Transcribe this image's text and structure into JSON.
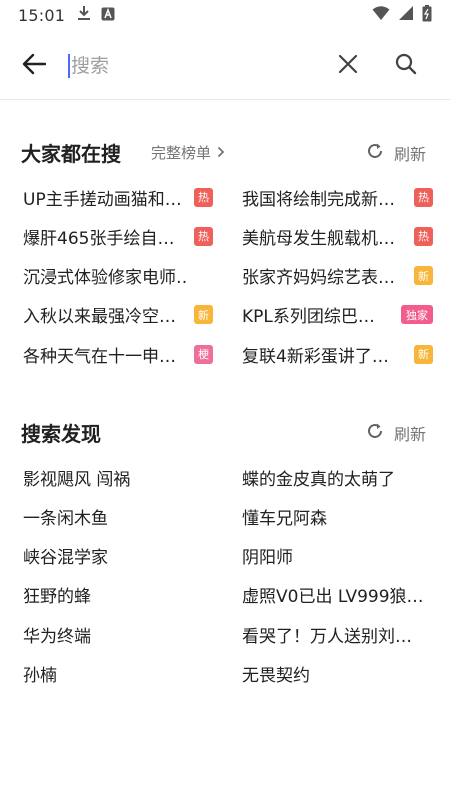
{
  "status_bar": {
    "time": "15:01"
  },
  "search": {
    "placeholder": "搜索"
  },
  "trending": {
    "title": "大家都在搜",
    "full_list_label": "完整榜单",
    "refresh_label": "刷新",
    "items": [
      {
        "text": "UP主手搓动画猫和…",
        "badge": "热",
        "badge_type": "hot"
      },
      {
        "text": "我国将绘制完成新…",
        "badge": "热",
        "badge_type": "hot"
      },
      {
        "text": "爆肝465张手绘自…",
        "badge": "热",
        "badge_type": "hot"
      },
      {
        "text": "美航母发生舰载机…",
        "badge": "热",
        "badge_type": "hot"
      },
      {
        "text": "沉浸式体验修家电师…",
        "badge": "",
        "badge_type": ""
      },
      {
        "text": "张家齐妈妈综艺表…",
        "badge": "新",
        "badge_type": "new"
      },
      {
        "text": "入秋以来最强冷空…",
        "badge": "新",
        "badge_type": "new"
      },
      {
        "text": "KPL系列团综巴…",
        "badge": "独家",
        "badge_type": "excl"
      },
      {
        "text": "各种天气在十一申…",
        "badge": "梗",
        "badge_type": "meme"
      },
      {
        "text": "复联4新彩蛋讲了…",
        "badge": "新",
        "badge_type": "new"
      }
    ]
  },
  "discover": {
    "title": "搜索发现",
    "refresh_label": "刷新",
    "items": [
      "影视飓风 闯祸",
      "蝶的金皮真的太萌了",
      "一条闲木鱼",
      "懂车兄阿森",
      "峡谷混学家",
      "阴阳师",
      "狂野的蜂",
      "虚照V0已出 LV999狼…",
      "华为终端",
      "看哭了！万人送别刘…",
      "孙楠",
      "无畏契约"
    ]
  },
  "colors": {
    "hot": "#f0605a",
    "new": "#f7b53a",
    "meme": "#ee6f9a",
    "excl": "#f25d8e",
    "caret": "#4a6cf7"
  }
}
